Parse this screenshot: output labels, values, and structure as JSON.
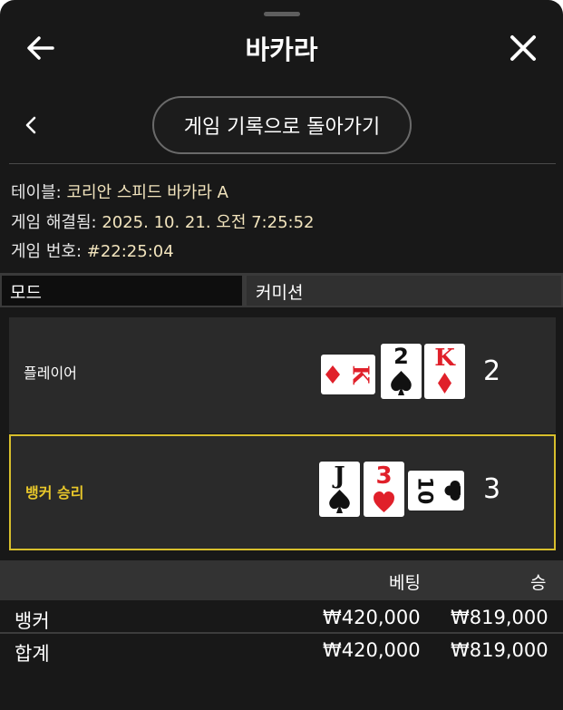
{
  "header": {
    "title": "바카라"
  },
  "nav": {
    "back_to_history": "게임 기록으로 돌아가기"
  },
  "info": {
    "table_label": "테이블:",
    "table_value": " 코리안 스피드 바카라 A",
    "resolved_label": "게임 해결됨:",
    "resolved_value": " 2025. 10. 21. 오전 7:25:52",
    "game_no_label": "게임 번호:",
    "game_no_value": " #22:25:04"
  },
  "tabs": {
    "mode": "모드",
    "commission": "커미션"
  },
  "player": {
    "label": "플레이어",
    "score": "2",
    "cards": [
      {
        "rank": "K",
        "suit": "diamond",
        "color": "red",
        "orientation": "sideways"
      },
      {
        "rank": "2",
        "suit": "spade",
        "color": "black",
        "orientation": "upright"
      },
      {
        "rank": "K",
        "suit": "diamond",
        "color": "red",
        "orientation": "upright"
      }
    ]
  },
  "banker": {
    "label": "뱅커 승리",
    "score": "3",
    "cards": [
      {
        "rank": "J",
        "suit": "spade",
        "color": "black",
        "orientation": "upright"
      },
      {
        "rank": "3",
        "suit": "heart",
        "color": "red",
        "orientation": "upright"
      },
      {
        "rank": "10",
        "suit": "club",
        "color": "black",
        "orientation": "sideways"
      }
    ]
  },
  "bets_table": {
    "headers": {
      "bet": "베팅",
      "win": "승"
    },
    "rows": [
      {
        "name": "뱅커",
        "bet": "₩420,000",
        "win": "₩819,000"
      },
      {
        "name": "합계",
        "bet": "₩420,000",
        "win": "₩819,000"
      }
    ]
  },
  "colors": {
    "accent_gold": "#d8bf2c",
    "card_red": "#e0202a",
    "background": "#181818"
  }
}
